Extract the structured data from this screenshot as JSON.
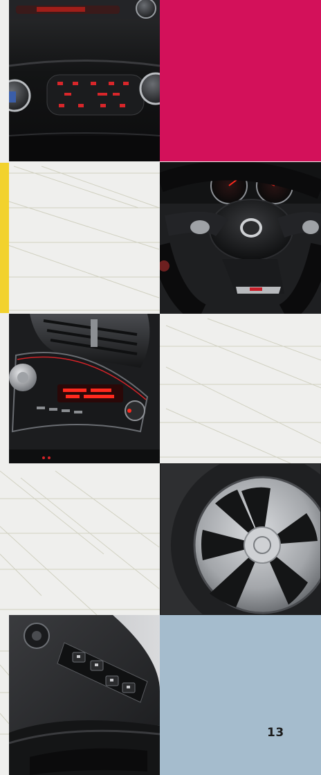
{
  "page": {
    "number": "13"
  },
  "colors": {
    "magenta": "#d3115a",
    "yellow": "#f2d22d",
    "steel_blue": "#a5bccd",
    "display_red": "#ff2a1e"
  },
  "tiles": [
    {
      "id": "climate-control",
      "kind": "photo"
    },
    {
      "id": "magenta-block",
      "kind": "color"
    },
    {
      "id": "yellow-accent",
      "kind": "color"
    },
    {
      "id": "steering-wheel",
      "kind": "photo"
    },
    {
      "id": "radio-unit",
      "kind": "photo"
    },
    {
      "id": "alloy-wheel",
      "kind": "photo"
    },
    {
      "id": "window-switches",
      "kind": "photo"
    },
    {
      "id": "blue-block",
      "kind": "color"
    }
  ]
}
